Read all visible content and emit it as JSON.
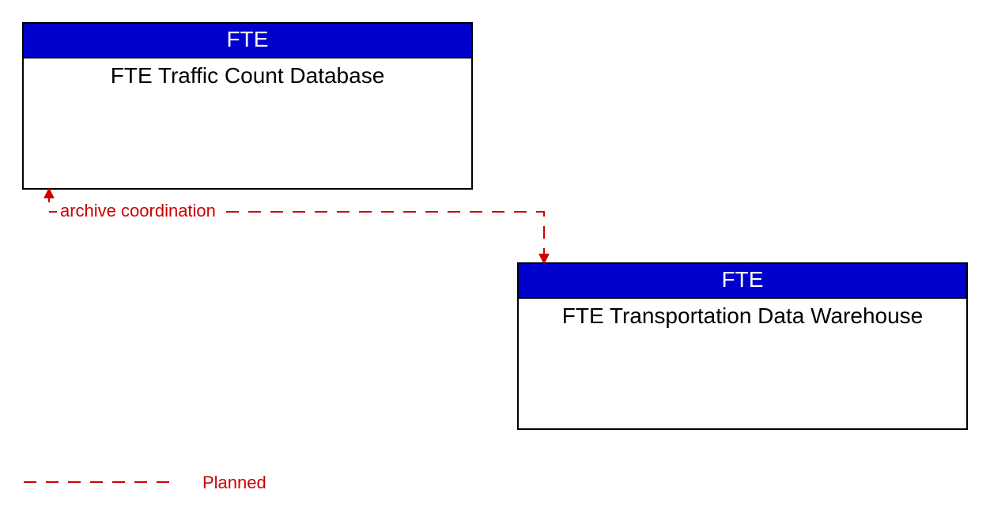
{
  "boxes": {
    "top": {
      "header": "FTE",
      "title": "FTE Traffic Count Database"
    },
    "bottom": {
      "header": "FTE",
      "title": "FTE Transportation Data Warehouse"
    }
  },
  "flow": {
    "label": "archive coordination"
  },
  "legend": {
    "label": "Planned"
  },
  "colors": {
    "header_bg": "#0000cc",
    "flow": "#cc0000"
  }
}
